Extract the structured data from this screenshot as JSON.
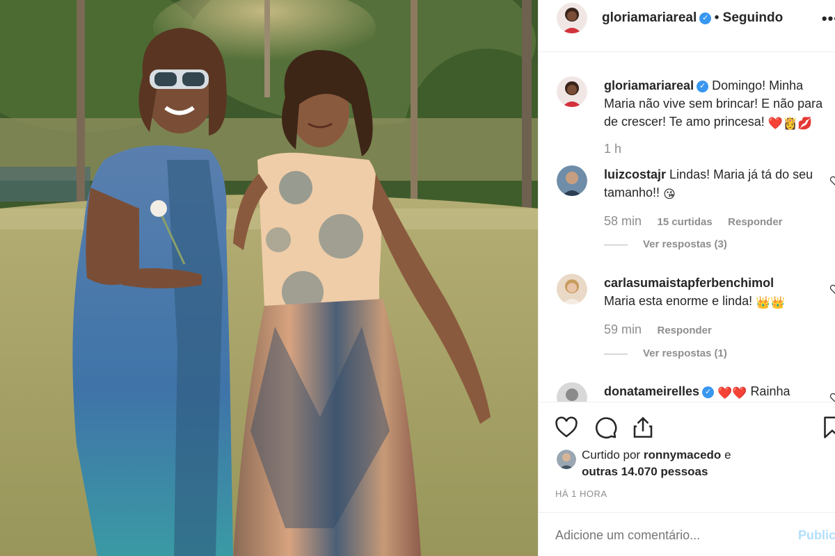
{
  "post": {
    "username": "gloriamariareal",
    "follow_status": "Seguindo",
    "more": "•••"
  },
  "caption": {
    "username": "gloriamariareal",
    "text": "Domingo! Minha Maria não vive sem brincar! E não para de crescer! Te amo princesa!",
    "emojis": "❤️👸💋",
    "time": "1 h"
  },
  "comments": [
    {
      "username": "luizcostajr",
      "text": "Lindas! Maria já tá do seu tamanho!!",
      "emoji": "😘",
      "time": "58 min",
      "likes": "15 curtidas",
      "reply": "Responder",
      "view_replies": "Ver respostas (3)"
    },
    {
      "username": "carlasumaistapferbenchimol",
      "text": "Maria esta enorme e linda!",
      "emoji": "👑👑",
      "time": "59 min",
      "reply": "Responder",
      "view_replies": "Ver respostas (1)"
    },
    {
      "username": "donatameirelles",
      "text": "Rainha",
      "emoji": "❤️❤️"
    }
  ],
  "likes": {
    "prefix": "Curtido por",
    "user": "ronnymacedo",
    "middle": "e",
    "others": "outras 14.070 pessoas"
  },
  "timestamp": "HÁ 1 HORA",
  "add_comment": {
    "placeholder": "Adicione um comentário...",
    "publish": "Publicar"
  },
  "colors": {
    "verified": "#3897f0",
    "publish": "#b2dffc",
    "secondary_text": "#8e8e8e"
  },
  "icons": [
    "like-icon",
    "comment-icon",
    "share-icon",
    "bookmark-icon",
    "heart-small-icon",
    "verified-badge-icon"
  ]
}
